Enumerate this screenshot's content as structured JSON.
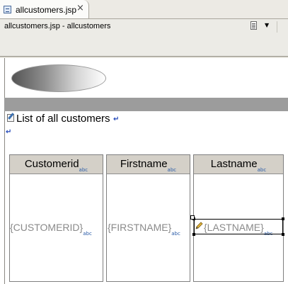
{
  "editor_tab": {
    "label": "allcustomers.jsp",
    "close_glyph": "×",
    "icon": "jsp-file-icon"
  },
  "editor_header": {
    "title": "allcustomers.jsp - allcustomers",
    "menu_glyph": "▼"
  },
  "design": {
    "heading": "List of all customers",
    "return_glyph": "↵",
    "table": {
      "type_badge": "abc",
      "columns": [
        {
          "header": "Customerid",
          "cell": "{CUSTOMERID}"
        },
        {
          "header": "Firstname",
          "cell": "{FIRSTNAME}"
        },
        {
          "header": "Lastname",
          "cell": "{LASTNAME}"
        }
      ]
    }
  },
  "colors": {
    "header_bg": "#d4d0c8",
    "accent": "#2a5ca8",
    "band": "#9c9c9c"
  }
}
